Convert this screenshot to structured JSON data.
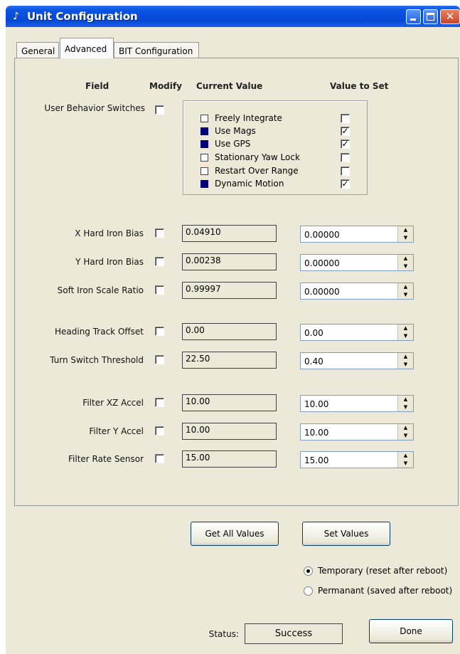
{
  "window": {
    "title": "Unit Configuration"
  },
  "tabs": [
    {
      "label": "General"
    },
    {
      "label": "Advanced"
    },
    {
      "label": "BIT Configuration"
    }
  ],
  "headers": {
    "field": "Field",
    "modify": "Modify",
    "current": "Current Value",
    "to_set": "Value to Set"
  },
  "user_behavior": {
    "label": "User Behavior Switches",
    "switches": [
      {
        "label": "Freely Integrate",
        "current_on": false,
        "set_checked": false
      },
      {
        "label": "Use Mags",
        "current_on": true,
        "set_checked": true
      },
      {
        "label": "Use GPS",
        "current_on": true,
        "set_checked": true
      },
      {
        "label": "Stationary Yaw Lock",
        "current_on": false,
        "set_checked": false
      },
      {
        "label": "Restart Over Range",
        "current_on": false,
        "set_checked": false
      },
      {
        "label": "Dynamic Motion",
        "current_on": true,
        "set_checked": true
      }
    ]
  },
  "fields": [
    {
      "label": "X Hard Iron Bias",
      "current": "0.04910",
      "set": "0.00000"
    },
    {
      "label": "Y Hard Iron Bias",
      "current": "0.00238",
      "set": "0.00000"
    },
    {
      "label": "Soft Iron Scale Ratio",
      "current": "0.99997",
      "set": "0.00000"
    },
    {
      "label": "Heading Track Offset",
      "current": "0.00",
      "set": "0.00"
    },
    {
      "label": "Turn Switch Threshold",
      "current": "22.50",
      "set": "0.40"
    },
    {
      "label": "Filter XZ Accel",
      "current": "10.00",
      "set": "10.00"
    },
    {
      "label": "Filter Y Accel",
      "current": "10.00",
      "set": "10.00"
    },
    {
      "label": "Filter Rate Sensor",
      "current": "15.00",
      "set": "15.00"
    }
  ],
  "buttons": {
    "get_all": "Get All Values",
    "set_values": "Set Values",
    "done": "Done"
  },
  "radios": [
    {
      "label": "Temporary (reset after reboot)",
      "selected": true
    },
    {
      "label": "Permanant (saved after reboot)",
      "selected": false
    }
  ],
  "status": {
    "label": "Status:",
    "value": "Success"
  },
  "icons": {
    "title": "app-icon",
    "check": "✓"
  }
}
